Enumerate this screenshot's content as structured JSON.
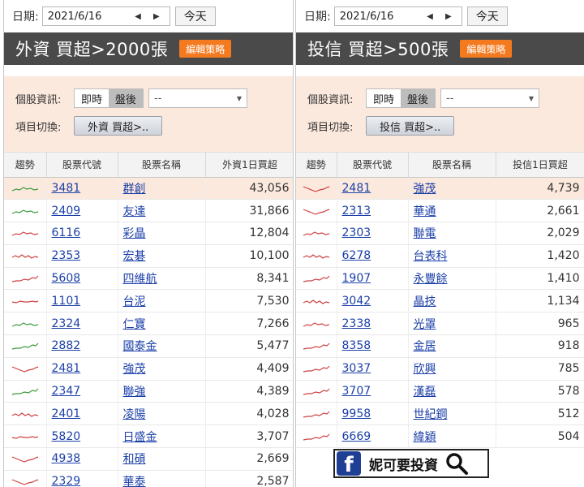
{
  "left": {
    "date_label": "日期:",
    "date_value": "2021/6/16",
    "date_arrows": "◀ ▶",
    "today_label": "今天",
    "title": "外資 買超>2000張",
    "edit_label": "編輯策略",
    "info_label": "個股資訊:",
    "seg_realtime": "即時",
    "seg_after": "盤後",
    "dropdown_value": "--",
    "switch_label": "項目切換:",
    "switch_button": "外資 買超>..",
    "headers": [
      "趨勢",
      "股票代號",
      "股票名稱",
      "外資1日買超"
    ],
    "rows": [
      {
        "code": "3481",
        "name": "群創",
        "value": "43,056",
        "color": "#3a9a3a",
        "shape": "up"
      },
      {
        "code": "2409",
        "name": "友達",
        "value": "31,866",
        "color": "#3a9a3a",
        "shape": "up"
      },
      {
        "code": "6116",
        "name": "彩晶",
        "value": "12,804",
        "color": "#d04040",
        "shape": "up"
      },
      {
        "code": "2353",
        "name": "宏碁",
        "value": "10,100",
        "color": "#d04040",
        "shape": "wave"
      },
      {
        "code": "5608",
        "name": "四維航",
        "value": "8,341",
        "color": "#d04040",
        "shape": "rise"
      },
      {
        "code": "1101",
        "name": "台泥",
        "value": "7,530",
        "color": "#d04040",
        "shape": "flat"
      },
      {
        "code": "2324",
        "name": "仁寶",
        "value": "7,266",
        "color": "#3a9a3a",
        "shape": "up"
      },
      {
        "code": "2882",
        "name": "國泰金",
        "value": "5,477",
        "color": "#3a9a3a",
        "shape": "rise"
      },
      {
        "code": "2481",
        "name": "強茂",
        "value": "4,409",
        "color": "#d04040",
        "shape": "dip"
      },
      {
        "code": "2347",
        "name": "聯強",
        "value": "4,389",
        "color": "#3a9a3a",
        "shape": "rise"
      },
      {
        "code": "2401",
        "name": "凌陽",
        "value": "4,028",
        "color": "#d04040",
        "shape": "wave"
      },
      {
        "code": "5820",
        "name": "日盛金",
        "value": "3,707",
        "color": "#d04040",
        "shape": "flat"
      },
      {
        "code": "4938",
        "name": "和碩",
        "value": "2,669",
        "color": "#d04040",
        "shape": "dip"
      },
      {
        "code": "2329",
        "name": "華泰",
        "value": "2,587",
        "color": "#d04040",
        "shape": "dip"
      }
    ]
  },
  "right": {
    "date_label": "日期:",
    "date_value": "2021/6/16",
    "date_arrows": "◀ ▶",
    "today_label": "今天",
    "title": "投信 買超>500張",
    "edit_label": "編輯策略",
    "info_label": "個股資訊:",
    "seg_realtime": "即時",
    "seg_after": "盤後",
    "dropdown_value": "--",
    "switch_label": "項目切換:",
    "switch_button": "投信 買超>..",
    "headers": [
      "趨勢",
      "股票代號",
      "股票名稱",
      "投信1日買超"
    ],
    "rows": [
      {
        "code": "2481",
        "name": "強茂",
        "value": "4,739",
        "color": "#d04040",
        "shape": "dip"
      },
      {
        "code": "2313",
        "name": "華通",
        "value": "2,661",
        "color": "#d04040",
        "shape": "dip"
      },
      {
        "code": "2303",
        "name": "聯電",
        "value": "2,029",
        "color": "#d04040",
        "shape": "up"
      },
      {
        "code": "6278",
        "name": "台表科",
        "value": "1,420",
        "color": "#d04040",
        "shape": "wave"
      },
      {
        "code": "1907",
        "name": "永豐餘",
        "value": "1,410",
        "color": "#d04040",
        "shape": "rise"
      },
      {
        "code": "3042",
        "name": "晶技",
        "value": "1,134",
        "color": "#d04040",
        "shape": "wave"
      },
      {
        "code": "2338",
        "name": "光罩",
        "value": "965",
        "color": "#d04040",
        "shape": "up"
      },
      {
        "code": "8358",
        "name": "金居",
        "value": "918",
        "color": "#d04040",
        "shape": "rise"
      },
      {
        "code": "3037",
        "name": "欣興",
        "value": "785",
        "color": "#d04040",
        "shape": "rise"
      },
      {
        "code": "3707",
        "name": "漢磊",
        "value": "578",
        "color": "#d04040",
        "shape": "rise"
      },
      {
        "code": "9958",
        "name": "世紀鋼",
        "value": "512",
        "color": "#d04040",
        "shape": "rise"
      },
      {
        "code": "6669",
        "name": "緯穎",
        "value": "504",
        "color": "#d04040",
        "shape": "rise"
      }
    ]
  },
  "banner": {
    "fb_letter": "f",
    "text": "妮可要投資",
    "icon": "search-icon"
  }
}
